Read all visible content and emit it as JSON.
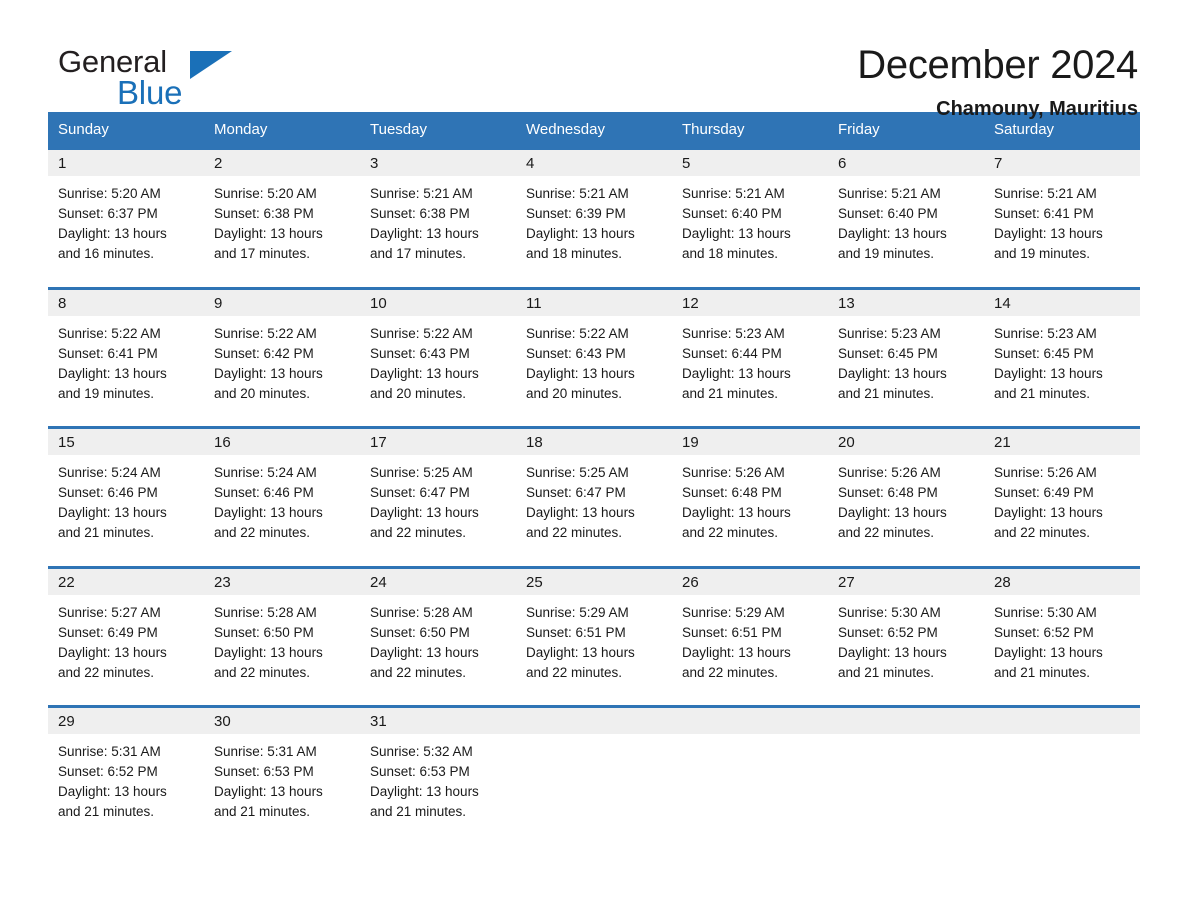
{
  "brand": {
    "name_top": "General",
    "name_bottom": "Blue",
    "accent_color": "#1a70b8",
    "triangle_icon": "triangle-icon"
  },
  "header": {
    "title": "December 2024",
    "location": "Chamouny, Mauritius"
  },
  "colors": {
    "header_blue": "#2f74b5",
    "daynum_gray": "#efefef",
    "text": "#1a1a1a"
  },
  "weekday_headers": [
    "Sunday",
    "Monday",
    "Tuesday",
    "Wednesday",
    "Thursday",
    "Friday",
    "Saturday"
  ],
  "weeks": [
    [
      {
        "day": "1",
        "sunrise": "Sunrise: 5:20 AM",
        "sunset": "Sunset: 6:37 PM",
        "daylight1": "Daylight: 13 hours",
        "daylight2": "and 16 minutes."
      },
      {
        "day": "2",
        "sunrise": "Sunrise: 5:20 AM",
        "sunset": "Sunset: 6:38 PM",
        "daylight1": "Daylight: 13 hours",
        "daylight2": "and 17 minutes."
      },
      {
        "day": "3",
        "sunrise": "Sunrise: 5:21 AM",
        "sunset": "Sunset: 6:38 PM",
        "daylight1": "Daylight: 13 hours",
        "daylight2": "and 17 minutes."
      },
      {
        "day": "4",
        "sunrise": "Sunrise: 5:21 AM",
        "sunset": "Sunset: 6:39 PM",
        "daylight1": "Daylight: 13 hours",
        "daylight2": "and 18 minutes."
      },
      {
        "day": "5",
        "sunrise": "Sunrise: 5:21 AM",
        "sunset": "Sunset: 6:40 PM",
        "daylight1": "Daylight: 13 hours",
        "daylight2": "and 18 minutes."
      },
      {
        "day": "6",
        "sunrise": "Sunrise: 5:21 AM",
        "sunset": "Sunset: 6:40 PM",
        "daylight1": "Daylight: 13 hours",
        "daylight2": "and 19 minutes."
      },
      {
        "day": "7",
        "sunrise": "Sunrise: 5:21 AM",
        "sunset": "Sunset: 6:41 PM",
        "daylight1": "Daylight: 13 hours",
        "daylight2": "and 19 minutes."
      }
    ],
    [
      {
        "day": "8",
        "sunrise": "Sunrise: 5:22 AM",
        "sunset": "Sunset: 6:41 PM",
        "daylight1": "Daylight: 13 hours",
        "daylight2": "and 19 minutes."
      },
      {
        "day": "9",
        "sunrise": "Sunrise: 5:22 AM",
        "sunset": "Sunset: 6:42 PM",
        "daylight1": "Daylight: 13 hours",
        "daylight2": "and 20 minutes."
      },
      {
        "day": "10",
        "sunrise": "Sunrise: 5:22 AM",
        "sunset": "Sunset: 6:43 PM",
        "daylight1": "Daylight: 13 hours",
        "daylight2": "and 20 minutes."
      },
      {
        "day": "11",
        "sunrise": "Sunrise: 5:22 AM",
        "sunset": "Sunset: 6:43 PM",
        "daylight1": "Daylight: 13 hours",
        "daylight2": "and 20 minutes."
      },
      {
        "day": "12",
        "sunrise": "Sunrise: 5:23 AM",
        "sunset": "Sunset: 6:44 PM",
        "daylight1": "Daylight: 13 hours",
        "daylight2": "and 21 minutes."
      },
      {
        "day": "13",
        "sunrise": "Sunrise: 5:23 AM",
        "sunset": "Sunset: 6:45 PM",
        "daylight1": "Daylight: 13 hours",
        "daylight2": "and 21 minutes."
      },
      {
        "day": "14",
        "sunrise": "Sunrise: 5:23 AM",
        "sunset": "Sunset: 6:45 PM",
        "daylight1": "Daylight: 13 hours",
        "daylight2": "and 21 minutes."
      }
    ],
    [
      {
        "day": "15",
        "sunrise": "Sunrise: 5:24 AM",
        "sunset": "Sunset: 6:46 PM",
        "daylight1": "Daylight: 13 hours",
        "daylight2": "and 21 minutes."
      },
      {
        "day": "16",
        "sunrise": "Sunrise: 5:24 AM",
        "sunset": "Sunset: 6:46 PM",
        "daylight1": "Daylight: 13 hours",
        "daylight2": "and 22 minutes."
      },
      {
        "day": "17",
        "sunrise": "Sunrise: 5:25 AM",
        "sunset": "Sunset: 6:47 PM",
        "daylight1": "Daylight: 13 hours",
        "daylight2": "and 22 minutes."
      },
      {
        "day": "18",
        "sunrise": "Sunrise: 5:25 AM",
        "sunset": "Sunset: 6:47 PM",
        "daylight1": "Daylight: 13 hours",
        "daylight2": "and 22 minutes."
      },
      {
        "day": "19",
        "sunrise": "Sunrise: 5:26 AM",
        "sunset": "Sunset: 6:48 PM",
        "daylight1": "Daylight: 13 hours",
        "daylight2": "and 22 minutes."
      },
      {
        "day": "20",
        "sunrise": "Sunrise: 5:26 AM",
        "sunset": "Sunset: 6:48 PM",
        "daylight1": "Daylight: 13 hours",
        "daylight2": "and 22 minutes."
      },
      {
        "day": "21",
        "sunrise": "Sunrise: 5:26 AM",
        "sunset": "Sunset: 6:49 PM",
        "daylight1": "Daylight: 13 hours",
        "daylight2": "and 22 minutes."
      }
    ],
    [
      {
        "day": "22",
        "sunrise": "Sunrise: 5:27 AM",
        "sunset": "Sunset: 6:49 PM",
        "daylight1": "Daylight: 13 hours",
        "daylight2": "and 22 minutes."
      },
      {
        "day": "23",
        "sunrise": "Sunrise: 5:28 AM",
        "sunset": "Sunset: 6:50 PM",
        "daylight1": "Daylight: 13 hours",
        "daylight2": "and 22 minutes."
      },
      {
        "day": "24",
        "sunrise": "Sunrise: 5:28 AM",
        "sunset": "Sunset: 6:50 PM",
        "daylight1": "Daylight: 13 hours",
        "daylight2": "and 22 minutes."
      },
      {
        "day": "25",
        "sunrise": "Sunrise: 5:29 AM",
        "sunset": "Sunset: 6:51 PM",
        "daylight1": "Daylight: 13 hours",
        "daylight2": "and 22 minutes."
      },
      {
        "day": "26",
        "sunrise": "Sunrise: 5:29 AM",
        "sunset": "Sunset: 6:51 PM",
        "daylight1": "Daylight: 13 hours",
        "daylight2": "and 22 minutes."
      },
      {
        "day": "27",
        "sunrise": "Sunrise: 5:30 AM",
        "sunset": "Sunset: 6:52 PM",
        "daylight1": "Daylight: 13 hours",
        "daylight2": "and 21 minutes."
      },
      {
        "day": "28",
        "sunrise": "Sunrise: 5:30 AM",
        "sunset": "Sunset: 6:52 PM",
        "daylight1": "Daylight: 13 hours",
        "daylight2": "and 21 minutes."
      }
    ],
    [
      {
        "day": "29",
        "sunrise": "Sunrise: 5:31 AM",
        "sunset": "Sunset: 6:52 PM",
        "daylight1": "Daylight: 13 hours",
        "daylight2": "and 21 minutes."
      },
      {
        "day": "30",
        "sunrise": "Sunrise: 5:31 AM",
        "sunset": "Sunset: 6:53 PM",
        "daylight1": "Daylight: 13 hours",
        "daylight2": "and 21 minutes."
      },
      {
        "day": "31",
        "sunrise": "Sunrise: 5:32 AM",
        "sunset": "Sunset: 6:53 PM",
        "daylight1": "Daylight: 13 hours",
        "daylight2": "and 21 minutes."
      },
      {
        "day": "",
        "sunrise": "",
        "sunset": "",
        "daylight1": "",
        "daylight2": ""
      },
      {
        "day": "",
        "sunrise": "",
        "sunset": "",
        "daylight1": "",
        "daylight2": ""
      },
      {
        "day": "",
        "sunrise": "",
        "sunset": "",
        "daylight1": "",
        "daylight2": ""
      },
      {
        "day": "",
        "sunrise": "",
        "sunset": "",
        "daylight1": "",
        "daylight2": ""
      }
    ]
  ]
}
